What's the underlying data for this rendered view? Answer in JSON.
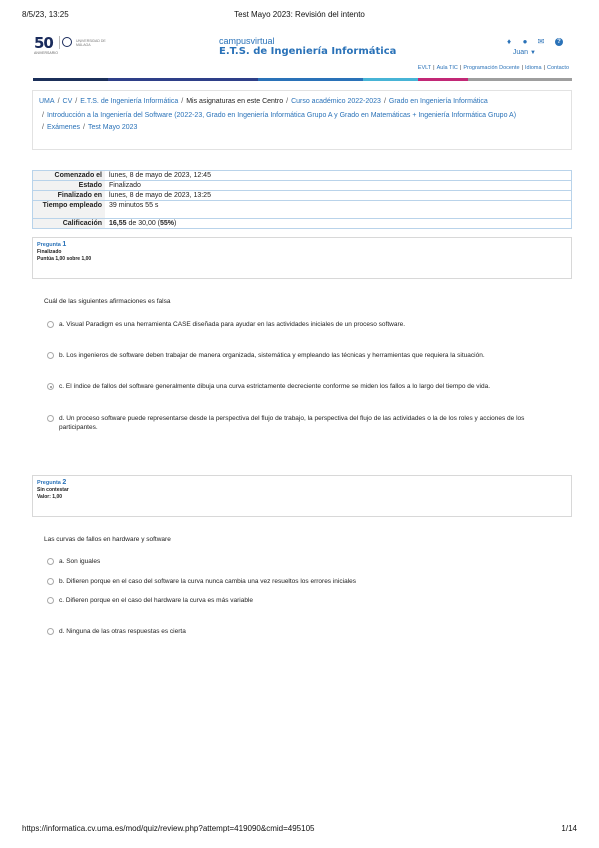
{
  "print_header": {
    "datetime": "8/5/23, 13:25",
    "title": "Test Mayo 2023: Revisión del intento"
  },
  "logo": {
    "number": "50",
    "subtitle": "ANIVERSARIO",
    "university": "UNIVERSIDAD DE MÁLAGA"
  },
  "brand": {
    "line1": "campusvirtual",
    "line2": "E.T.S. de Ingeniería Informática"
  },
  "user": {
    "name": "Juan"
  },
  "toplinks": [
    "EVLT",
    "Aula TIC",
    "Programación Docente",
    "Idioma",
    "Contacto"
  ],
  "colorbar": [
    "#1b2f59",
    "#2e3f88",
    "#2a72b8",
    "#47b4d6",
    "#c22876",
    "#9e9e9e"
  ],
  "breadcrumb": {
    "row1": [
      "UMA",
      "CV",
      "E.T.S. de Ingeniería Informática"
    ],
    "current": "Mis asignaturas en este Centro",
    "row1_after": [
      "Curso académico 2022-2023",
      "Grado en Ingeniería Informática"
    ],
    "course": "Introducción a la Ingeniería del Software (2022-23, Grado en Ingeniería Informática Grupo A y Grado en Matemáticas + Ingeniería Informática Grupo A)",
    "row3": [
      "Exámenes",
      "Test Mayo 2023"
    ]
  },
  "summary": [
    {
      "key": "Comenzado el",
      "value": "lunes, 8 de mayo de 2023, 12:45"
    },
    {
      "key": "Estado",
      "value": "Finalizado"
    },
    {
      "key": "Finalizado en",
      "value": "lunes, 8 de mayo de 2023, 13:25"
    },
    {
      "key": "Tiempo empleado",
      "value": "39 minutos 55 s"
    },
    {
      "key": "Calificación",
      "value_bold": "16,55",
      "value_rest": " de 30,00 (",
      "value_pct": "55%",
      "value_end": ")"
    }
  ],
  "q1": {
    "label": "Pregunta",
    "number": "1",
    "state": "Finalizado",
    "mark": "Puntúa 1,00 sobre 1,00",
    "text": "Cuál de las siguientes afirmaciones es falsa",
    "options": [
      "a. Visual Paradigm es una herramienta CASE diseñada para ayudar en las actividades iniciales de un proceso software.",
      "b. Los ingenieros de software deben trabajar de manera organizada, sistemática y empleando las técnicas y herramientas que requiera la situación.",
      "c. El índice de fallos del software generalmente dibuja una curva estrictamente decreciente conforme se miden los fallos a lo largo del tiempo de vida.",
      "d. Un proceso software puede representarse desde la perspectiva del flujo de trabajo, la perspectiva del flujo de las actividades o la de los roles y acciones de los participantes."
    ]
  },
  "q2": {
    "label": "Pregunta",
    "number": "2",
    "state": "Sin contestar",
    "mark": "Valor: 1,00",
    "text": "Las curvas de fallos en hardware y software",
    "options": [
      "a. Son iguales",
      "b. Difieren porque en el caso del software la curva nunca cambia una vez resueltos los errores iniciales",
      "c. Difieren porque en el caso del hardware la curva es más variable",
      "d. Ninguna de las otras respuestas es cierta"
    ]
  },
  "print_footer": {
    "url": "https://informatica.cv.uma.es/mod/quiz/review.php?attempt=419090&cmid=495105",
    "page": "1/14"
  }
}
